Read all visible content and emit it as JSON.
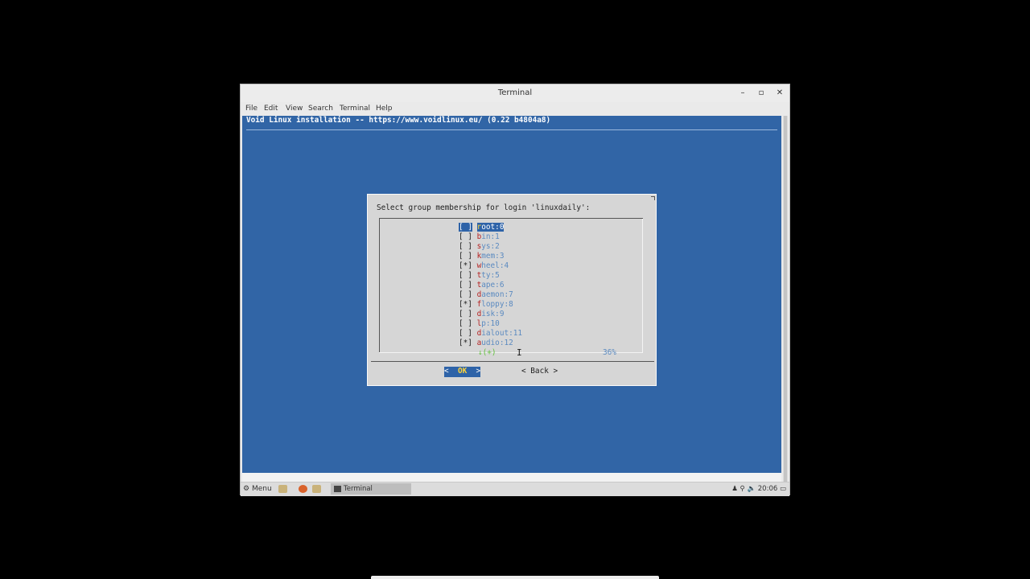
{
  "window": {
    "title": "Terminal",
    "minimize": "–",
    "maximize": "▫",
    "close": "✕",
    "menu": [
      "File",
      "Edit",
      "View",
      "Search",
      "Terminal",
      "Help"
    ]
  },
  "terminal": {
    "header": "Void Linux installation -- https://www.voidlinux.eu/ (0.22 b4804a8)"
  },
  "dialog": {
    "prompt": "Select group membership for login 'linuxdaily':",
    "items": [
      {
        "check": "[ ]",
        "hot": "r",
        "rest": "oot:0"
      },
      {
        "check": "[ ]",
        "hot": "b",
        "rest": "in:1"
      },
      {
        "check": "[ ]",
        "hot": "s",
        "rest": "ys:2"
      },
      {
        "check": "[ ]",
        "hot": "k",
        "rest": "mem:3"
      },
      {
        "check": "[*]",
        "hot": "w",
        "rest": "heel:4"
      },
      {
        "check": "[ ]",
        "hot": "t",
        "rest": "ty:5"
      },
      {
        "check": "[ ]",
        "hot": "t",
        "rest": "ape:6"
      },
      {
        "check": "[ ]",
        "hot": "d",
        "rest": "aemon:7"
      },
      {
        "check": "[*]",
        "hot": "f",
        "rest": "loppy:8"
      },
      {
        "check": "[ ]",
        "hot": "d",
        "rest": "isk:9"
      },
      {
        "check": "[ ]",
        "hot": "l",
        "rest": "p:10"
      },
      {
        "check": "[ ]",
        "hot": "d",
        "rest": "ialout:11"
      },
      {
        "check": "[*]",
        "hot": "a",
        "rest": "udio:12"
      }
    ],
    "more_indicator": "↓(+)",
    "scroll_percent": "36%",
    "ok_left": "<  ",
    "ok_label": "OK",
    "ok_right": "  >",
    "back_label": "< Back >"
  },
  "taskbar": {
    "menu_label": "Menu",
    "task_terminal": "Terminal",
    "clock": "20:06"
  }
}
